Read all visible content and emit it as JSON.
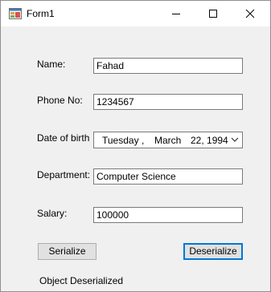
{
  "window": {
    "title": "Form1",
    "icon": "winforms-app-icon",
    "controls": {
      "minimize": "minimize-icon",
      "maximize": "maximize-icon",
      "close": "close-icon"
    }
  },
  "form": {
    "name": {
      "label": "Name:",
      "value": "Fahad"
    },
    "phone": {
      "label": "Phone No:",
      "value": "1234567"
    },
    "dob": {
      "label": "Date of birth",
      "weekday": "Tuesday",
      "sep": ",",
      "month": "March",
      "day_year": "22, 1994",
      "dropdown_icon": "chevron-down-icon"
    },
    "department": {
      "label": "Department:",
      "value": "Computer Science"
    },
    "salary": {
      "label": "Salary:",
      "value": "100000"
    }
  },
  "buttons": {
    "serialize": "Serialize",
    "deserialize": "Deserialize"
  },
  "status": "Object Deserialized",
  "colors": {
    "focus_border": "#0078d7",
    "form_background": "#f0f0f0"
  }
}
